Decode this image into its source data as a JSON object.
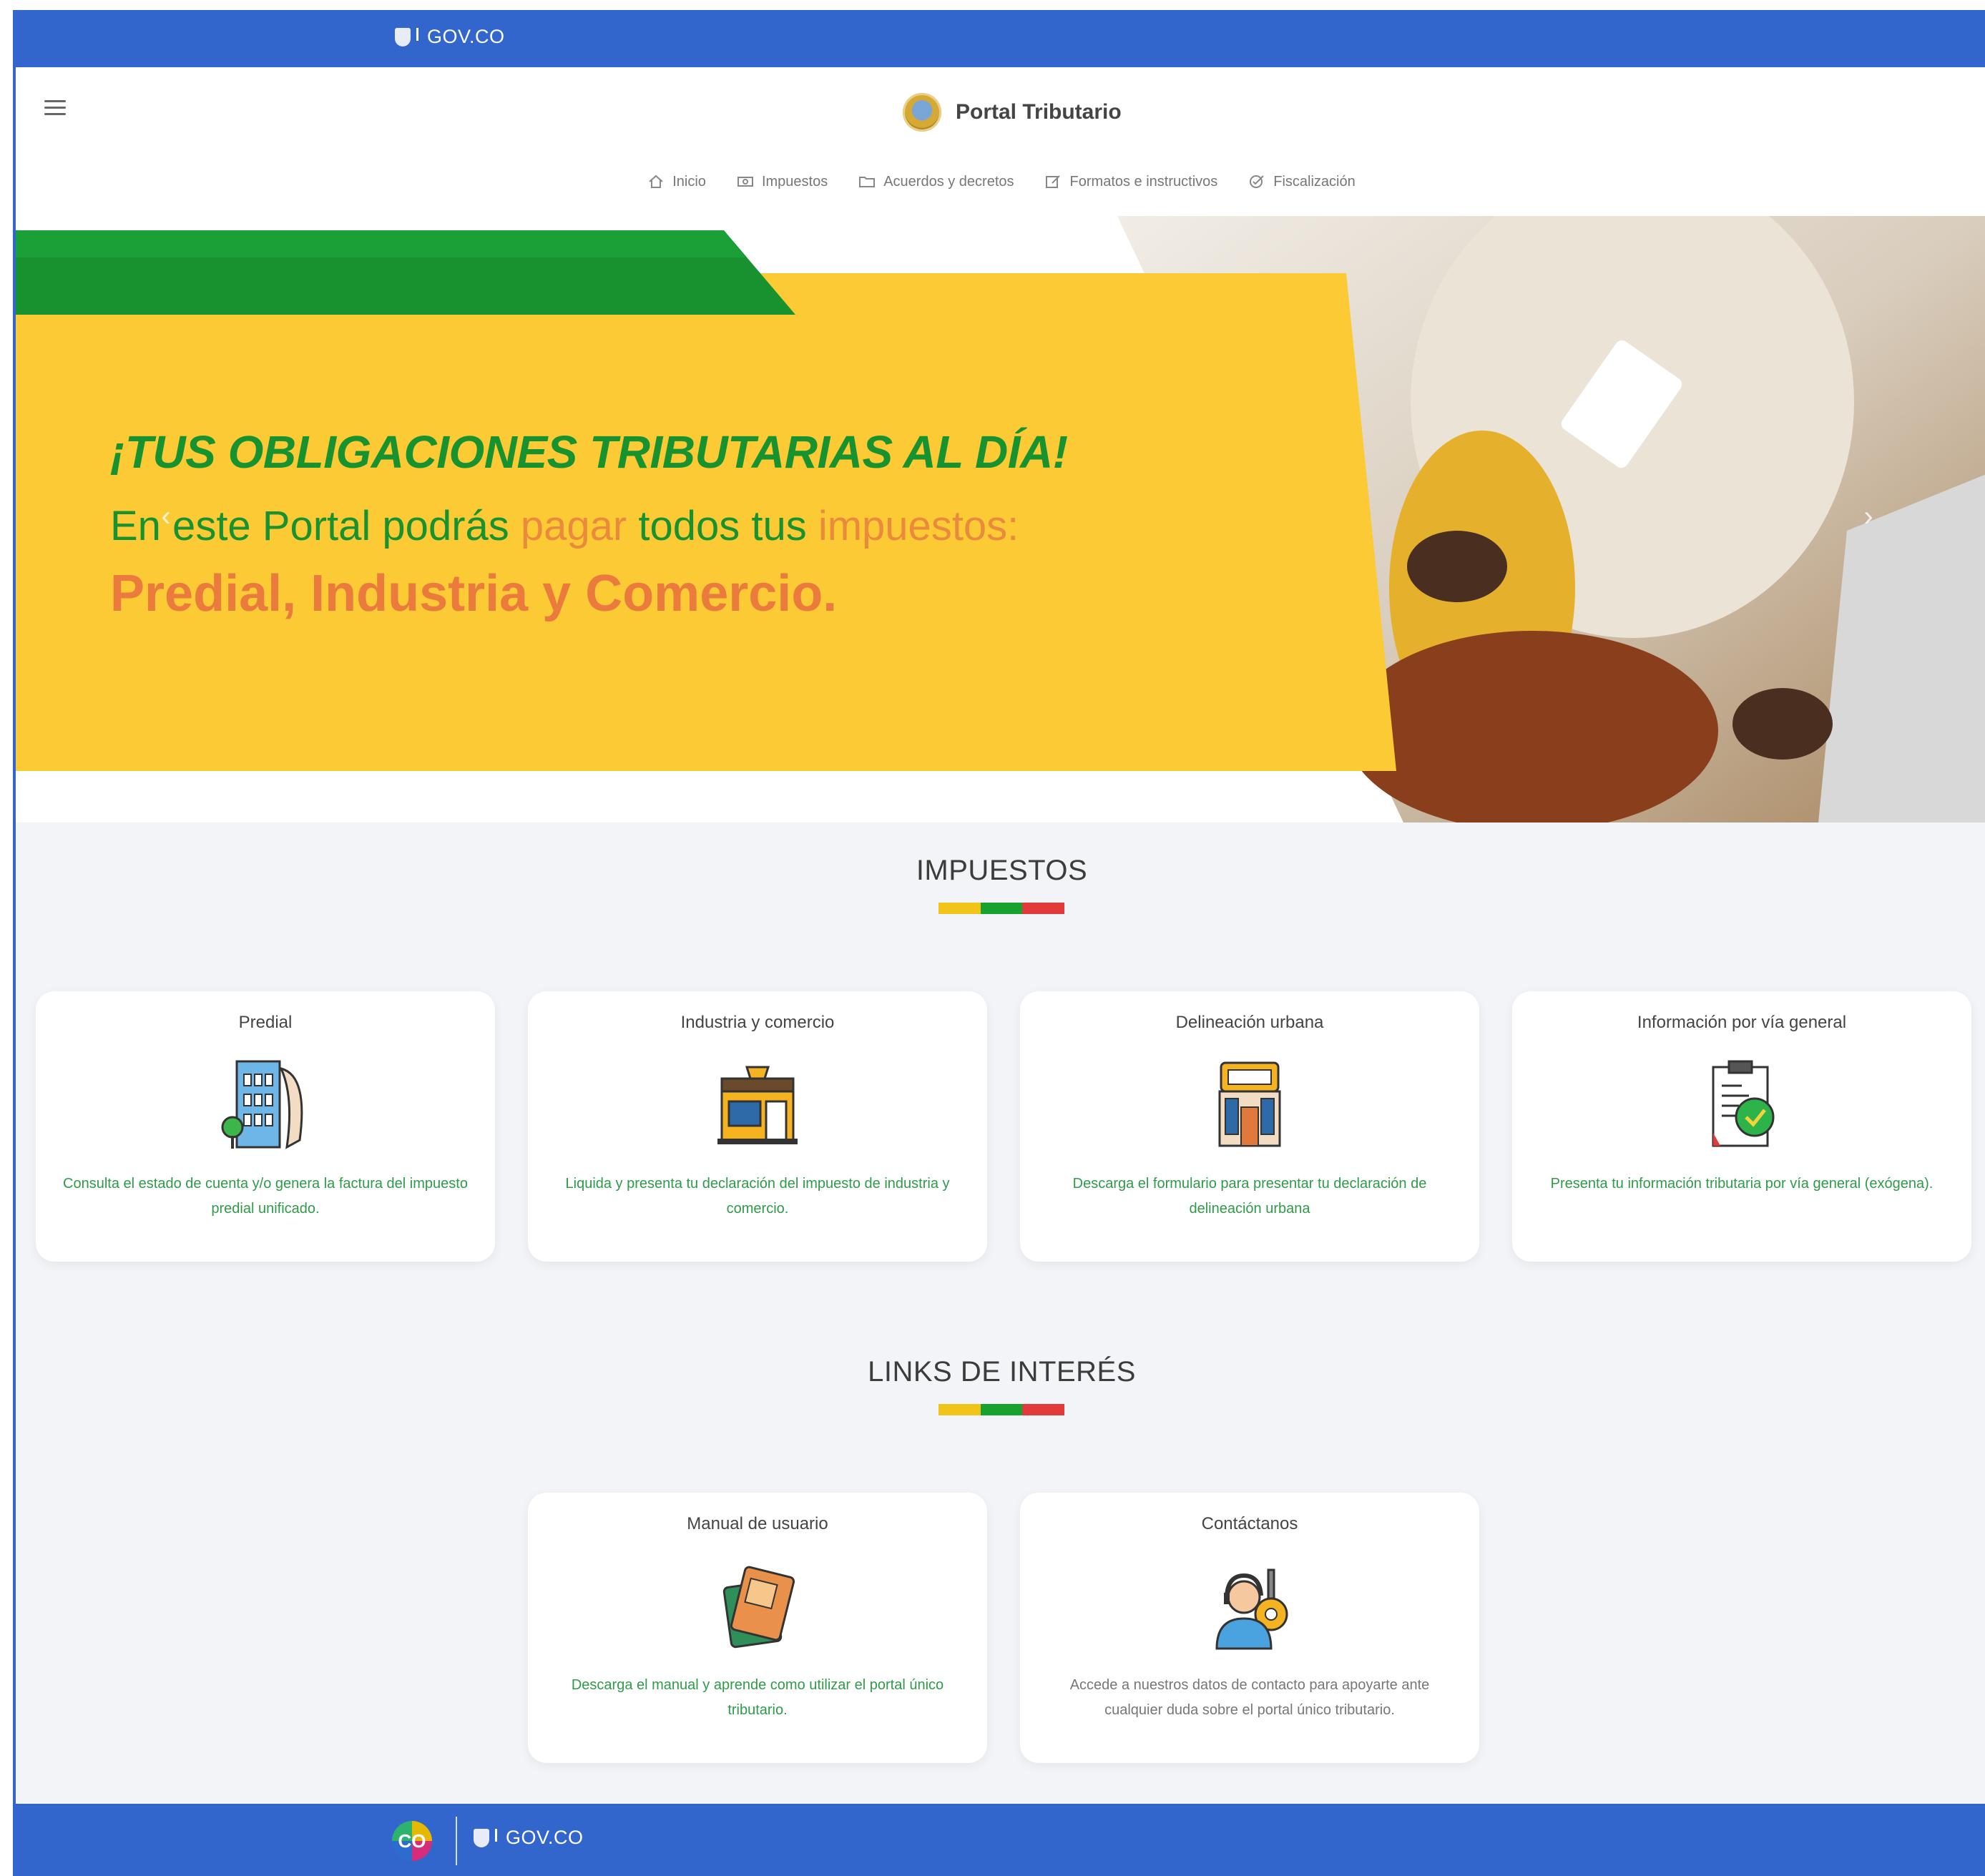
{
  "gov_bar": {
    "logo_text": "GOV.CO"
  },
  "header": {
    "title": "Portal Tributario"
  },
  "nav": {
    "items": [
      {
        "label": "Inicio",
        "icon": "home-icon"
      },
      {
        "label": "Impuestos",
        "icon": "money-icon"
      },
      {
        "label": "Acuerdos y decretos",
        "icon": "folder-icon"
      },
      {
        "label": "Formatos e instructivos",
        "icon": "edit-icon"
      },
      {
        "label": "Fiscalización",
        "icon": "check-circle-icon"
      }
    ]
  },
  "banner": {
    "headline": "¡TUS OBLIGACIONES TRIBUTARIAS AL DÍA!",
    "line2_a": "En este Portal podrás ",
    "line2_b": "pagar",
    "line2_c": " todos tus ",
    "line2_d": "impuestos:",
    "line3": "Predial, Industria y Comercio.",
    "prev": "‹",
    "next": "›",
    "colors": {
      "yellow": "#fcca35",
      "green": "#17922f",
      "orange": "#ea7b3c"
    }
  },
  "impuestos": {
    "title": "IMPUESTOS",
    "cards": [
      {
        "title": "Predial",
        "icon": "building-icon",
        "description": "Consulta el estado de cuenta y/o genera la factura del impuesto predial unificado."
      },
      {
        "title": "Industria y comercio",
        "icon": "store-icon",
        "description": "Liquida y presenta tu declaración del impuesto de industria y comercio."
      },
      {
        "title": "Delineación urbana",
        "icon": "city-building-icon",
        "description": "Descarga el formulario para presentar tu declaración de delineación urbana"
      },
      {
        "title": "Información por vía general",
        "icon": "clipboard-check-icon",
        "description": "Presenta tu información tributaria por vía general (exógena)."
      }
    ]
  },
  "links": {
    "title": "LINKS DE INTERÉS",
    "cards": [
      {
        "title": "Manual de usuario",
        "icon": "book-icon",
        "description": "Descarga el manual y aprende como utilizar el portal único tributario."
      },
      {
        "title": "Contáctanos",
        "icon": "support-agent-icon",
        "description": "Accede a nuestros datos de contacto para apoyarte ante cualquier duda sobre el portal único tributario."
      }
    ]
  },
  "footer": {
    "co_logo": "CO",
    "gov_text": "GOV.CO"
  },
  "divider_colors": [
    "#f0c419",
    "#17a12f",
    "#e23a3a"
  ],
  "accent": "#3366cc"
}
